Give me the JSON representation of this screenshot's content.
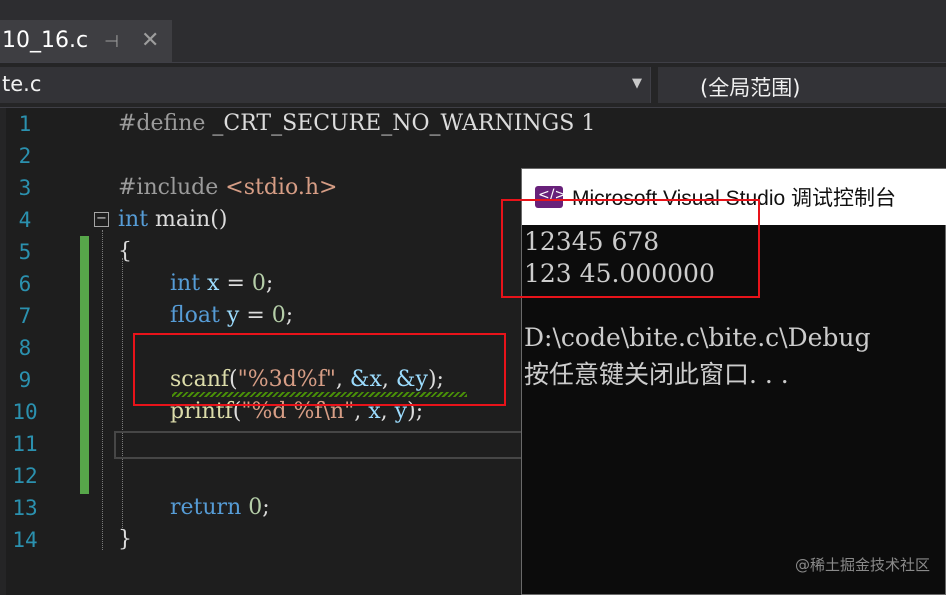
{
  "tab": {
    "filename": "10_16.c",
    "pin_glyph": "⊣",
    "close_glyph": "✕"
  },
  "navbar": {
    "file_combo": "te.c",
    "scope_combo": "(全局范围)"
  },
  "editor": {
    "line_numbers": [
      "1",
      "2",
      "3",
      "4",
      "5",
      "6",
      "7",
      "8",
      "9",
      "10",
      "11",
      "12",
      "13",
      "14"
    ],
    "lines": {
      "l1": {
        "directive": "#define",
        "macro": "_CRT_SECURE_NO_WARNINGS",
        "value": "1"
      },
      "l3": {
        "directive": "#include",
        "header": "<stdio.h>"
      },
      "l4": {
        "type": "int",
        "name": "main",
        "parens": "()"
      },
      "l5": {
        "brace": "{"
      },
      "l6": {
        "type": "int",
        "var": "x",
        "rest": " = ",
        "num": "0",
        "end": ";"
      },
      "l7": {
        "type": "float",
        "var": "y",
        "rest": " = ",
        "num": "0",
        "end": ";"
      },
      "l9": {
        "fn": "scanf",
        "open": "(",
        "fmt": "\"%3d%f\"",
        "sep": ", ",
        "a1": "&x",
        "sep2": ", ",
        "a2": "&y",
        "close": ");"
      },
      "l10": {
        "fn": "printf",
        "open": "(",
        "fmt": "\"%d %f\\n\"",
        "sep": ", ",
        "a1": "x",
        "sep2": ", ",
        "a2": "y",
        "close": ");"
      },
      "l13": {
        "kw": "return",
        "num": "0",
        "end": ";"
      },
      "l14": {
        "brace": "}"
      }
    }
  },
  "console": {
    "title": "Microsoft Visual Studio 调试控制台",
    "icon_glyph": "</>",
    "output": [
      "12345 678",
      "123 45.000000",
      "",
      "D:\\code\\bite.c\\bite.c\\Debug",
      "按任意键关闭此窗口. . ."
    ]
  },
  "watermark": "@稀土掘金技术社区",
  "colors": {
    "keyword": "#569cd6",
    "string": "#d69d85",
    "line_number": "#2b91af",
    "highlight_box": "#e8131a",
    "change_bar": "#57a64a"
  }
}
